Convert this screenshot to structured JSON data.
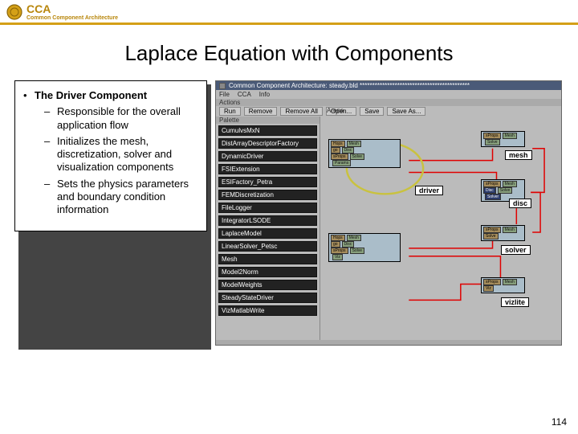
{
  "header": {
    "acronym": "CCA",
    "subtitle": "Common Component Architecture"
  },
  "title": "Laplace Equation with Components",
  "left": {
    "bullet": "•",
    "topic": "The Driver Component",
    "dash": "–",
    "sub1": "Responsible for the overall application flow",
    "sub2": "Initializes the mesh, discretization, solver and visualization components",
    "sub3": "Sets the physics parameters and boundary condition information"
  },
  "win": {
    "title": "Common Component Architecture: steady.bld ********************************************",
    "menu": {
      "file": "File",
      "cca": "CCA",
      "info": "Info"
    },
    "actions_label": "Actions",
    "buttons": {
      "run": "Run",
      "remove": "Remove",
      "remove_all": "Remove All",
      "open": "Open...",
      "save": "Save",
      "save_as": "Save As..."
    },
    "palette_label": "Palette",
    "arena_label": "Arena",
    "palette": {
      "p0": "CumulvsMxN",
      "p1": "DistArrayDescriptorFactory",
      "p2": "DynamicDriver",
      "p3": "FSIExtension",
      "p4": "ESIFactory_Petra",
      "p5": "FEMDiscretization",
      "p6": "FileLogger",
      "p7": "IntegratorLSODE",
      "p8": "LaplaceModel",
      "p9": "LinearSolver_Petsc",
      "p10": "Mesh",
      "p11": "Model2Norm",
      "p12": "ModelWeights",
      "p13": "SteadyStateDriver",
      "p14": "VizMatlabWrite"
    },
    "comp_labels": {
      "mesh": "mesh",
      "driver": "driver",
      "disc": "disc",
      "solver": "solver",
      "vizlite": "vizlite"
    },
    "pins": {
      "hops": "Hops",
      "go": "go",
      "sProps": "sProps",
      "mesh": "Mesh",
      "disc": "Disc",
      "solve": "Solve",
      "params": "Params",
      "solver": "Solver",
      "viz": "Viz"
    }
  },
  "page_number": "114"
}
